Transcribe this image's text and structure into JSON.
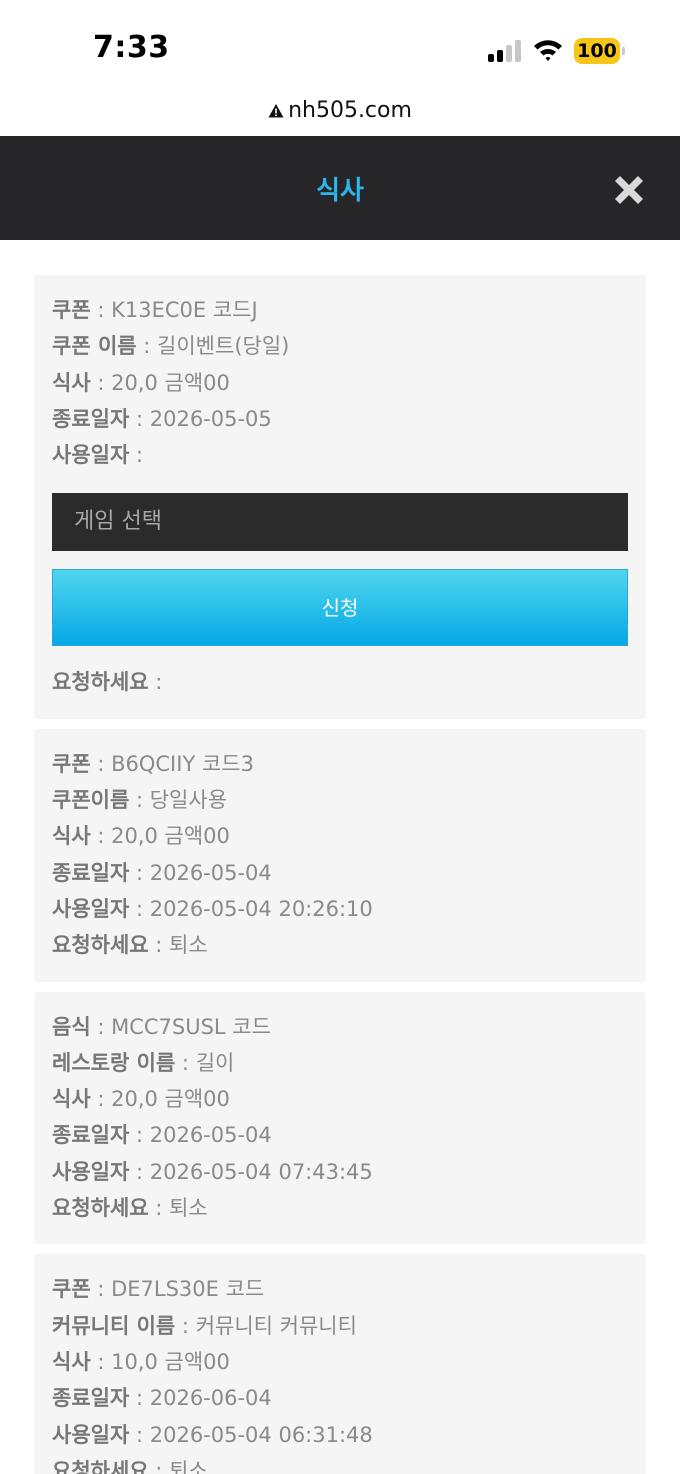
{
  "status_bar": {
    "time": "7:33",
    "battery": "100"
  },
  "browser": {
    "url": "nh505.com"
  },
  "header": {
    "title": "식사"
  },
  "cards": [
    {
      "rows": [
        {
          "label": "쿠폰",
          "value": "K13EC0E 코드J"
        },
        {
          "label": "쿠폰 이름",
          "value": "길이벤트(당일)"
        },
        {
          "label": "식사",
          "value": "20,0 금액00"
        },
        {
          "label": "종료일자",
          "value": "2026-05-05"
        },
        {
          "label": "사용일자",
          "value": ""
        }
      ],
      "select_placeholder": "게임 선택",
      "button_label": "신청",
      "status": {
        "label": "요청하세요",
        "value": ""
      }
    },
    {
      "rows": [
        {
          "label": "쿠폰",
          "value": "B6QCIIY 코드3"
        },
        {
          "label": "쿠폰이름",
          "value": "당일사용"
        },
        {
          "label": "식사",
          "value": "20,0 금액00"
        },
        {
          "label": "종료일자",
          "value": "2026-05-04"
        },
        {
          "label": "사용일자",
          "value": "2026-05-04 20:26:10"
        },
        {
          "label": "요청하세요",
          "value": "퇴소"
        }
      ]
    },
    {
      "rows": [
        {
          "label": "음식",
          "value": "MCC7SUSL 코드"
        },
        {
          "label": "레스토랑 이름",
          "value": "길이"
        },
        {
          "label": "식사",
          "value": "20,0 금액00"
        },
        {
          "label": "종료일자",
          "value": "2026-05-04"
        },
        {
          "label": "사용일자",
          "value": "2026-05-04 07:43:45"
        },
        {
          "label": "요청하세요",
          "value": "퇴소"
        }
      ]
    },
    {
      "rows": [
        {
          "label": "쿠폰",
          "value": "DE7LS30E 코드"
        },
        {
          "label": "커뮤니티 이름",
          "value": "커뮤니티 커뮤니티"
        },
        {
          "label": "식사",
          "value": "10,0 금액00"
        },
        {
          "label": "종료일자",
          "value": "2026-06-04"
        },
        {
          "label": "사용일자",
          "value": "2026-05-04 06:31:48"
        },
        {
          "label": "요청하세요",
          "value": "퇴소"
        }
      ]
    }
  ],
  "separator": ":",
  "icons": {
    "close": "close-icon",
    "warning": "warning-icon",
    "signal": "cellular-signal-icon",
    "wifi": "wifi-icon",
    "battery": "battery-icon"
  },
  "colors": {
    "header_bg": "#262629",
    "title": "#2bb7ee",
    "button": "#05a7e6",
    "battery": "#f5c518"
  }
}
